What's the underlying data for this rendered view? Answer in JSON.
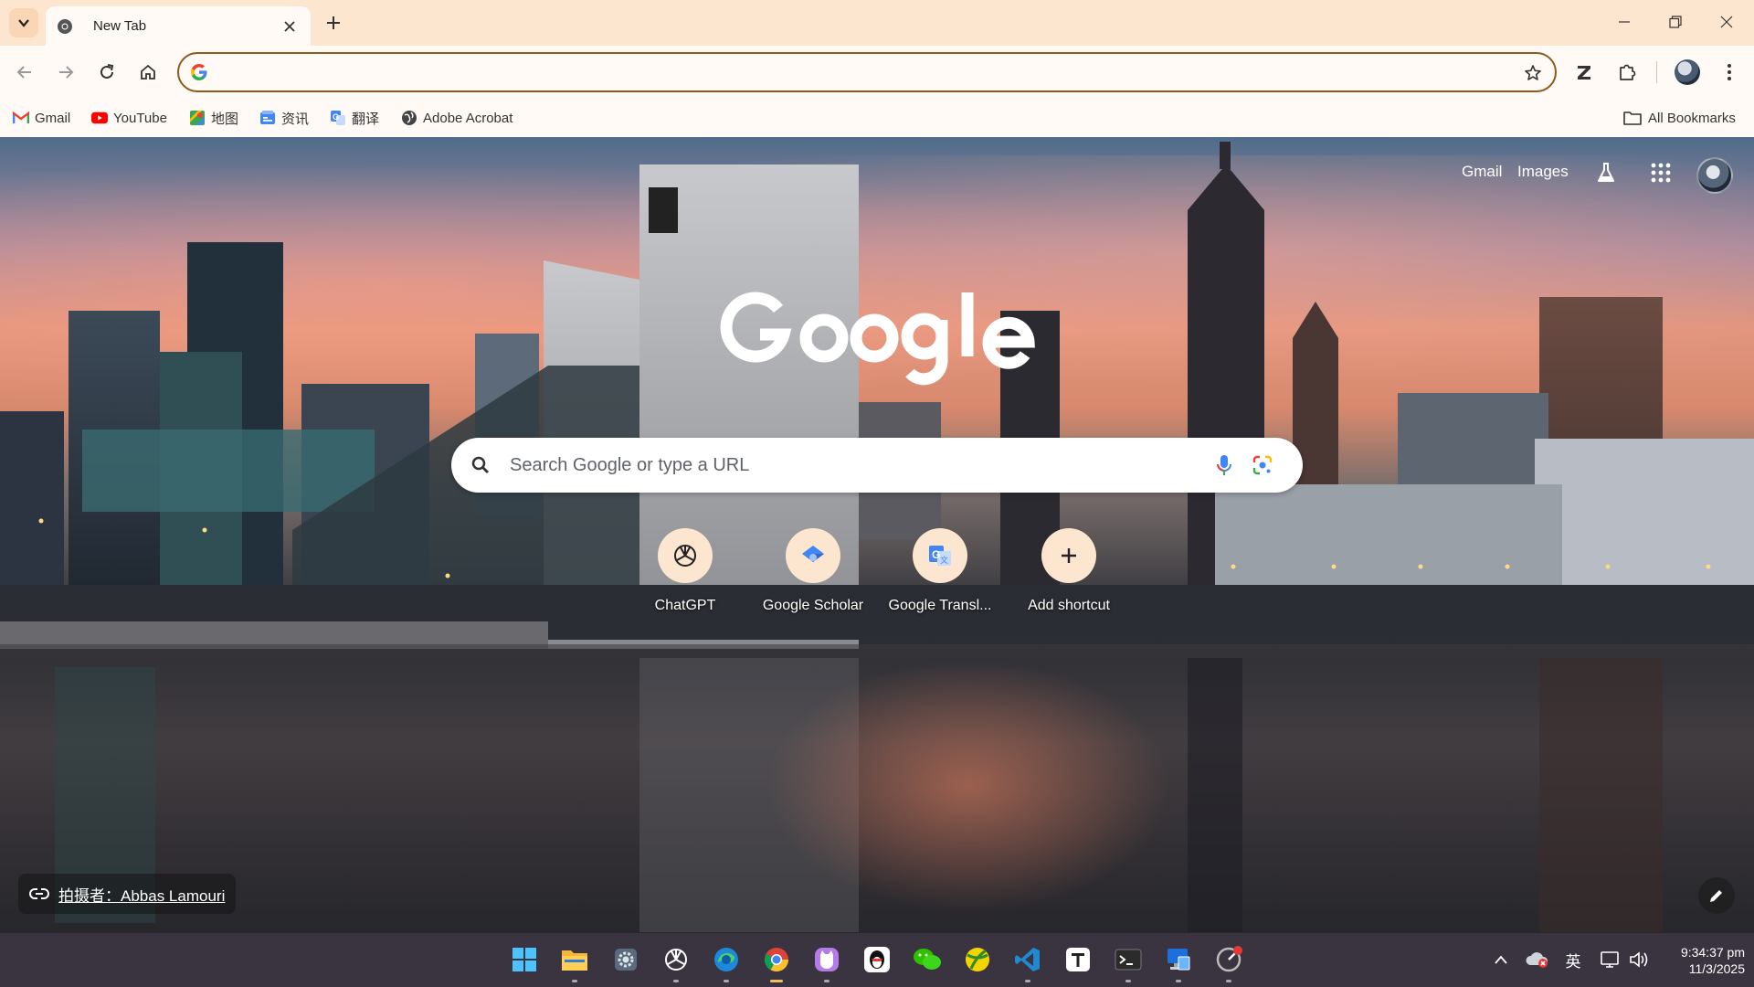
{
  "tab": {
    "title": "New Tab"
  },
  "omnibox": {
    "value": ""
  },
  "bookmarks": [
    {
      "label": "Gmail",
      "icon": "gmail-icon"
    },
    {
      "label": "YouTube",
      "icon": "youtube-icon"
    },
    {
      "label": "地图",
      "icon": "maps-icon"
    },
    {
      "label": "资讯",
      "icon": "news-icon"
    },
    {
      "label": "翻译",
      "icon": "translate-icon"
    },
    {
      "label": "Adobe Acrobat",
      "icon": "globe-icon"
    }
  ],
  "all_bookmarks": "All Bookmarks",
  "ntp": {
    "gmail": "Gmail",
    "images": "Images",
    "search_placeholder": "Search Google or type a URL",
    "shortcuts": [
      {
        "label": "ChatGPT",
        "icon": "chatgpt-icon"
      },
      {
        "label": "Google Scholar",
        "icon": "scholar-icon"
      },
      {
        "label": "Google Transl...",
        "icon": "google-translate-icon"
      },
      {
        "label": "Add shortcut",
        "icon": "plus-icon"
      }
    ],
    "credit": "拍摄者：Abbas Lamouri"
  },
  "taskbar": {
    "apps": [
      "start",
      "file-explorer",
      "settings",
      "chatgpt",
      "edge",
      "chrome",
      "cat-app",
      "qq",
      "wechat",
      "ball-app",
      "vscode",
      "typora",
      "terminal",
      "remote-desktop",
      "gauge-app"
    ],
    "language": "英",
    "time": "9:34:37 pm",
    "date": "11/3/2025"
  },
  "colors": {
    "chrome_bg": "#fde6cf",
    "toolbar_bg": "#fffaf5",
    "omnibox_border": "#8c5a1a",
    "taskbar_bg": "#3a3440"
  }
}
